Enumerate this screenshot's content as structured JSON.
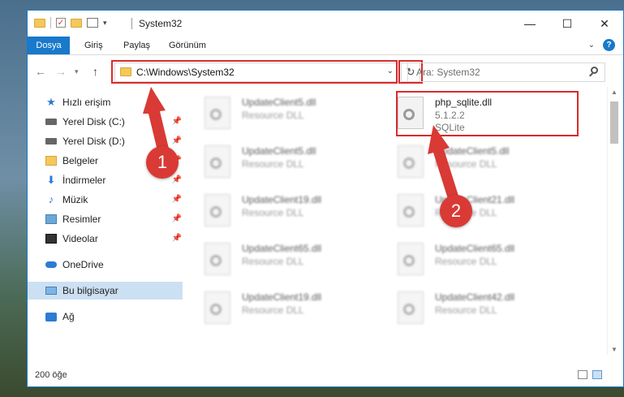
{
  "window": {
    "title": "System32",
    "minimize": "—",
    "maximize": "☐",
    "close": "✕"
  },
  "ribbon": {
    "tabs": [
      "Dosya",
      "Giriş",
      "Paylaş",
      "Görünüm"
    ],
    "help": "?"
  },
  "address": {
    "path": "C:\\Windows\\System32",
    "search_placeholder": "Ara: System32"
  },
  "sidebar": {
    "items": [
      {
        "label": "Hızlı erişim",
        "icon": "star-icon"
      },
      {
        "label": "Yerel Disk (C:)",
        "icon": "disk-icon",
        "pinned": true
      },
      {
        "label": "Yerel Disk (D:)",
        "icon": "disk-icon",
        "pinned": true
      },
      {
        "label": "Belgeler",
        "icon": "folder-icon",
        "pinned": true
      },
      {
        "label": "İndirmeler",
        "icon": "download-icon",
        "pinned": true
      },
      {
        "label": "Müzik",
        "icon": "music-icon",
        "pinned": true
      },
      {
        "label": "Resimler",
        "icon": "pictures-icon",
        "pinned": true
      },
      {
        "label": "Videolar",
        "icon": "video-icon",
        "pinned": true
      },
      {
        "label": "OneDrive",
        "icon": "cloud-icon"
      },
      {
        "label": "Bu bilgisayar",
        "icon": "pc-icon",
        "selected": true
      },
      {
        "label": "Ağ",
        "icon": "network-icon"
      }
    ]
  },
  "files": [
    {
      "name": "UpdateClient5.dll",
      "sub1": "Resource DLL",
      "sub2": ""
    },
    {
      "name": "php_sqlite.dll",
      "sub1": "5.1.2.2",
      "sub2": "SQLite"
    },
    {
      "name": "UpdateClient5.dll",
      "sub1": "Resource DLL",
      "sub2": ""
    },
    {
      "name": "UpdateClient5.dll",
      "sub1": "Resource DLL",
      "sub2": ""
    },
    {
      "name": "UpdateClient19.dll",
      "sub1": "Resource DLL",
      "sub2": ""
    },
    {
      "name": "UpdateClient21.dll",
      "sub1": "Resource DLL",
      "sub2": ""
    },
    {
      "name": "UpdateClient65.dll",
      "sub1": "Resource DLL",
      "sub2": ""
    },
    {
      "name": "UpdateClient65.dll",
      "sub1": "Resource DLL",
      "sub2": ""
    },
    {
      "name": "UpdateClient19.dll",
      "sub1": "Resource DLL",
      "sub2": ""
    },
    {
      "name": "UpdateClient42.dll",
      "sub1": "Resource DLL",
      "sub2": ""
    }
  ],
  "status": {
    "count": "200 öğe"
  },
  "annotations": {
    "badge1": "1",
    "badge2": "2"
  },
  "colors": {
    "accent": "#1979ca",
    "highlight": "#d92b2b",
    "badge": "#d93a35"
  }
}
